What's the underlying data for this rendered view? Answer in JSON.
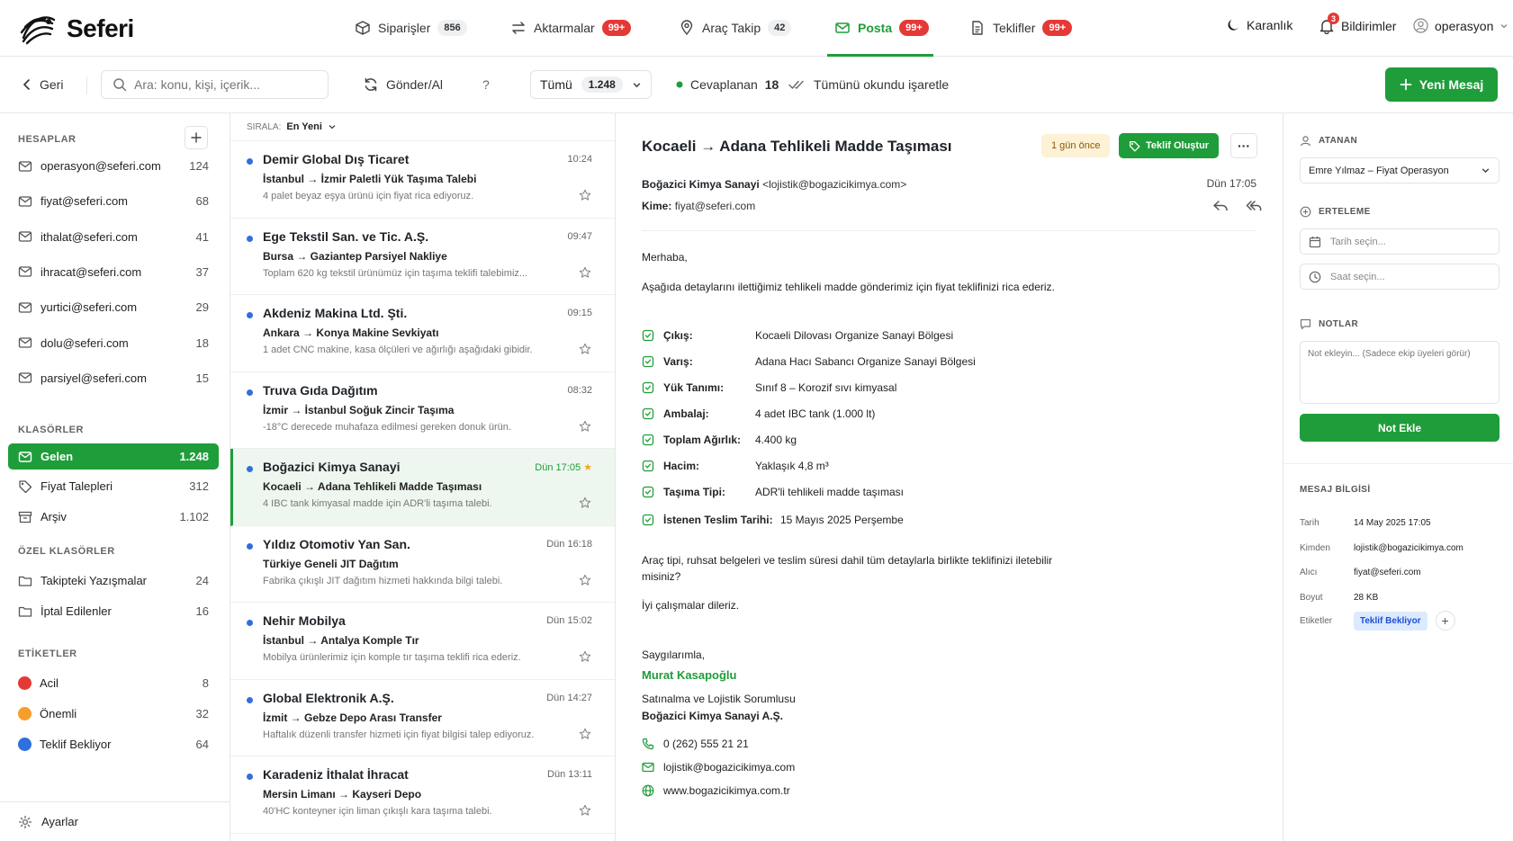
{
  "app": {
    "name": "Seferi"
  },
  "nav": {
    "items": [
      {
        "label": "Siparişler",
        "badge": "856"
      },
      {
        "label": "Aktarmalar",
        "badge": "99+"
      },
      {
        "label": "Araç Takip",
        "badge": "42"
      },
      {
        "label": "Posta",
        "badge": "99+"
      },
      {
        "label": "Teklifler",
        "badge": "99+"
      }
    ],
    "theme_label": "Karanlık",
    "notifications_label": "Bildirimler",
    "notifications_count": "3",
    "user_label": "operasyon"
  },
  "toolbar": {
    "back_label": "Geri",
    "search_placeholder": "Ara: konu, kişi, içerik...",
    "sync_label": "Gönder/Al",
    "help_label": "?",
    "filter_label": "Tümü",
    "filter_count": "1.248",
    "answered_label": "Cevaplanan",
    "answered_count": "18",
    "mark_all_label": "Tümünü okundu işaretle",
    "new_message_label": "Yeni Mesaj"
  },
  "sidebar": {
    "accounts_title": "HESAPLAR",
    "accounts": [
      {
        "label": "operasyon@seferi.com",
        "count": "124"
      },
      {
        "label": "fiyat@seferi.com",
        "count": "68"
      },
      {
        "label": "ithalat@seferi.com",
        "count": "41"
      },
      {
        "label": "ihracat@seferi.com",
        "count": "37"
      },
      {
        "label": "yurtici@seferi.com",
        "count": "29"
      },
      {
        "label": "dolu@seferi.com",
        "count": "18"
      },
      {
        "label": "parsiyel@seferi.com",
        "count": "15"
      }
    ],
    "folders_title": "KLASÖRLER",
    "folders": [
      {
        "label": "Gelen",
        "count": "1.248"
      },
      {
        "label": "Fiyat Talepleri",
        "count": "312"
      },
      {
        "label": "Arşiv",
        "count": "1.102"
      }
    ],
    "custom_title": "ÖZEL KLASÖRLER",
    "custom": [
      {
        "label": "Takipteki Yazışmalar",
        "count": "24"
      },
      {
        "label": "İptal Edilenler",
        "count": "16"
      }
    ],
    "labels_title": "ETİKETLER",
    "labels": [
      {
        "label": "Acil",
        "count": "8",
        "color": "#e53935"
      },
      {
        "label": "Önemli",
        "count": "32",
        "color": "#f59e2b"
      },
      {
        "label": "Teklif Bekliyor",
        "count": "64",
        "color": "#2f6fde"
      }
    ],
    "settings_label": "Ayarlar"
  },
  "list": {
    "sort_label": "SIRALA:",
    "sort_value": "En Yeni",
    "messages": [
      {
        "sender": "Demir Global Dış Ticaret",
        "time": "10:24",
        "subject": "İstanbul → İzmir Paletli Yük Taşıma Talebi",
        "preview": "4 palet beyaz eşya ürünü için fiyat rica ediyoruz."
      },
      {
        "sender": "Ege Tekstil San. ve Tic. A.Ş.",
        "time": "09:47",
        "subject": "Bursa → Gaziantep Parsiyel Nakliye",
        "preview": "Toplam 620 kg tekstil ürünümüz için taşıma teklifi talebimiz..."
      },
      {
        "sender": "Akdeniz Makina Ltd. Şti.",
        "time": "09:15",
        "subject": "Ankara → Konya Makine Sevkiyatı",
        "preview": "1 adet CNC makine, kasa ölçüleri ve ağırlığı aşağıdaki gibidir."
      },
      {
        "sender": "Truva Gıda Dağıtım",
        "time": "08:32",
        "subject": "İzmir → İstanbul Soğuk Zincir Taşıma",
        "preview": "-18°C derecede muhafaza edilmesi gereken donuk ürün."
      },
      {
        "sender": "Boğazici Kimya Sanayi",
        "time": "Dün 17:05",
        "subject": "Kocaeli → Adana Tehlikeli Madde Taşıması",
        "preview": "4 IBC tank kimyasal madde için ADR'li taşıma talebi."
      },
      {
        "sender": "Yıldız Otomotiv Yan San.",
        "time": "Dün 16:18",
        "subject": "Türkiye Geneli JIT Dağıtım",
        "preview": "Fabrika çıkışlı JIT dağıtım hizmeti hakkında bilgi talebi."
      },
      {
        "sender": "Nehir Mobilya",
        "time": "Dün 15:02",
        "subject": "İstanbul → Antalya Komple Tır",
        "preview": "Mobilya ürünlerimiz için komple tır taşıma teklifi rica ederiz."
      },
      {
        "sender": "Global Elektronik A.Ş.",
        "time": "Dün 14:27",
        "subject": "İzmit → Gebze Depo Arası Transfer",
        "preview": "Haftalık düzenli transfer hizmeti için fiyat bilgisi talep ediyoruz."
      },
      {
        "sender": "Karadeniz İthalat İhracat",
        "time": "Dün 13:11",
        "subject": "Mersin Limanı → Kayseri Depo",
        "preview": "40'HC konteyner için liman çıkışlı kara taşıma talebi."
      }
    ]
  },
  "reader": {
    "subject": "Kocaeli → Adana Tehlikeli Madde Taşıması",
    "age": "1 gün önce",
    "quote_label": "Teklif Oluştur",
    "more_label": "···",
    "from_name": "Boğazici Kimya Sanayi",
    "from_email": "<lojistik@bogazicikimya.com>",
    "to_label": "Kime:",
    "to_value": "fiyat@seferi.com",
    "date": "Dün 17:05",
    "greeting": "Merhaba,",
    "intro": "Aşağıda detaylarını ilettiğimiz tehlikeli madde gönderimiz için fiyat teklifinizi rica ederiz.",
    "details": [
      {
        "label": "Çıkış:",
        "value": "Kocaeli Dilovası Organize Sanayi Bölgesi"
      },
      {
        "label": "Varış:",
        "value": "Adana Hacı Sabancı Organize Sanayi Bölgesi"
      },
      {
        "label": "Yük Tanımı:",
        "value": "Sınıf 8 – Korozif sıvı kimyasal"
      },
      {
        "label": "Ambalaj:",
        "value": "4 adet IBC tank (1.000 lt)"
      },
      {
        "label": "Toplam Ağırlık:",
        "value": "4.400 kg"
      },
      {
        "label": "Hacim:",
        "value": "Yaklaşık 4,8 m³"
      },
      {
        "label": "Taşıma Tipi:",
        "value": "ADR'li tehlikeli madde taşıması"
      },
      {
        "label": "İstenen Teslim Tarihi:",
        "value": "15 Mayıs 2025 Perşembe"
      }
    ],
    "question_1": "Araç tipi, ruhsat belgeleri ve teslim süresi dahil tüm detaylarla birlikte teklifinizi iletebilir",
    "question_2": "misiniz?",
    "wishes": "İyi çalışmalar dileriz.",
    "regards": "Saygılarımla,",
    "sig_name": "Murat Kasapoğlu",
    "sig_title": "Satınalma ve Lojistik Sorumlusu",
    "sig_company": "Boğazici Kimya Sanayi A.Ş.",
    "phone": "0 (262) 555 21 21",
    "email": "lojistik@bogazicikimya.com",
    "web": "www.bogazicikimya.com.tr"
  },
  "panel": {
    "assignee_title": "ATANAN",
    "assignee_value": "Emre Yılmaz – Fiyat Operasyon",
    "snooze_title": "ERTELEME",
    "date_placeholder": "Tarih seçin...",
    "time_placeholder": "Saat seçin...",
    "notes_title": "NOTLAR",
    "notes_placeholder": "Not ekleyin... (Sadece ekip üyeleri görür)",
    "add_note_label": "Not Ekle",
    "info_title": "MESAJ BİLGİSİ",
    "info": [
      {
        "key": "Tarih",
        "value": "14 May 2025 17:05"
      },
      {
        "key": "Kimden",
        "value": "lojistik@bogazicikimya.com"
      },
      {
        "key": "Alıcı",
        "value": "fiyat@seferi.com"
      },
      {
        "key": "Boyut",
        "value": "28 KB"
      }
    ],
    "tags_key": "Etiketler",
    "tag": "Teklif Bekliyor",
    "tag_add": "+"
  }
}
